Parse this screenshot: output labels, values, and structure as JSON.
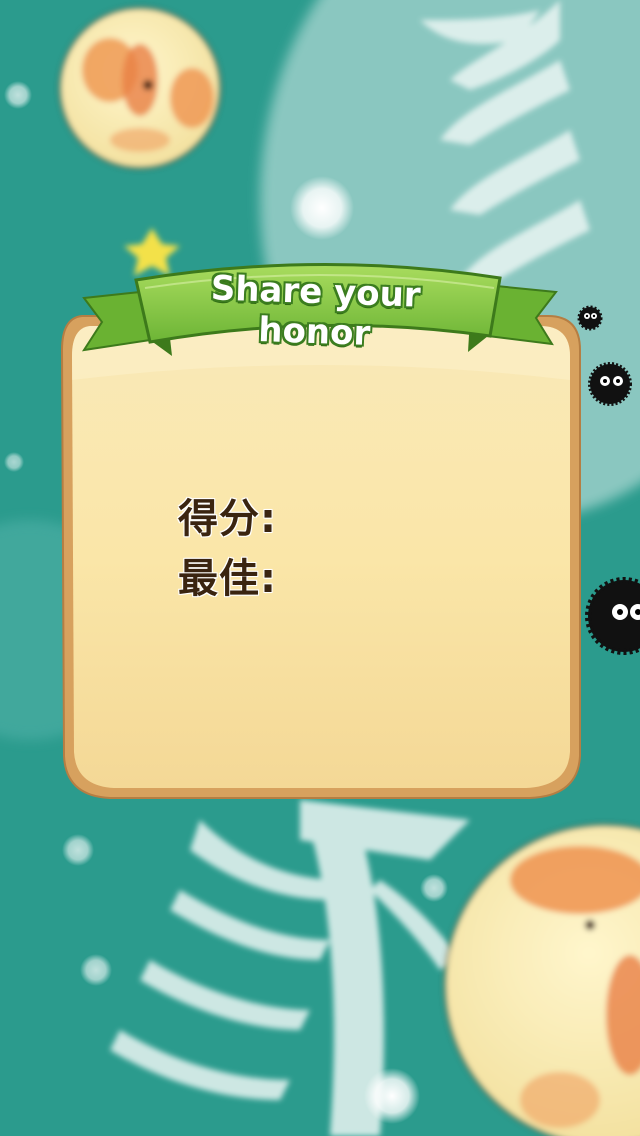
{
  "dialog": {
    "title": "Share your honor",
    "score_label": "得分:",
    "best_label": "最佳:"
  },
  "colors": {
    "background": "#2a9a8c",
    "panel": "#f8e4a8",
    "panel_border": "#d9a86a",
    "banner": "#8ccf4a",
    "text": "#3a2410"
  },
  "icons": {
    "creatures": "soot-sprite-icon",
    "planet": "planet-icon",
    "star": "star-icon"
  }
}
